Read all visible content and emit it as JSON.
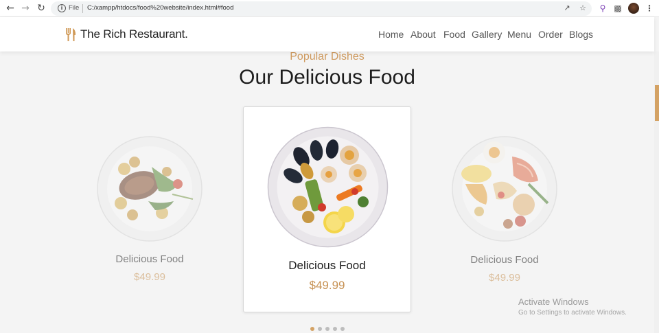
{
  "browser": {
    "file_label": "File",
    "url": "C:/xampp/htdocs/food%20website/index.html#food"
  },
  "header": {
    "brand": "The Rich Restaurant.",
    "nav": [
      "Home",
      "About",
      "Food",
      "Gallery",
      "Menu",
      "Order",
      "Blogs"
    ]
  },
  "section": {
    "subtitle": "Popular Dishes",
    "title": "Our Delicious Food"
  },
  "cards": [
    {
      "name": "Delicious Food",
      "price": "$49.99"
    },
    {
      "name": "Delicious Food",
      "price": "$49.99"
    },
    {
      "name": "Delicious Food",
      "price": "$49.99"
    }
  ],
  "pagination": {
    "count": 5,
    "active_index": 0
  },
  "watermark": {
    "title": "Activate Windows",
    "subtitle": "Go to Settings to activate Windows."
  },
  "colors": {
    "accent": "#cf9a5e",
    "price": "#c79254",
    "heading": "#1c1c1c"
  }
}
